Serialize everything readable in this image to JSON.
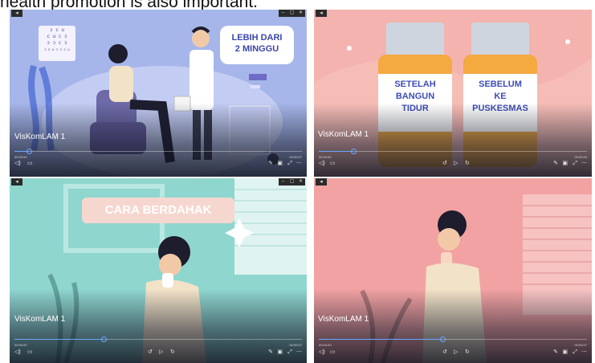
{
  "caption": "health promotion is also important.",
  "panels": [
    {
      "id": "p1",
      "title": "VisKomLAM 1",
      "progress": 0.05,
      "time_start": "00:00:00",
      "time_end": "00:00:07",
      "scene_text": [
        "LEBIH DARI",
        "2 MINGGU"
      ],
      "chart_text": [
        "ɔ c u",
        "c u c ɔ",
        "ɔ ɔ c ɔ",
        "ɔ n u ɔ ɔ ɔ u"
      ]
    },
    {
      "id": "p2",
      "title": "VisKomLAM 1",
      "progress": 0.13,
      "time_start": "00:00:00",
      "time_end": "00:00:00",
      "bottle_left": [
        "SETELAH",
        "BANGUN",
        "TIDUR"
      ],
      "bottle_right": [
        "SEBELUM",
        "KE",
        "PUSKESMAS"
      ]
    },
    {
      "id": "p3",
      "title": "VisKomLAM 1",
      "progress": 0.31,
      "time_start": "00:00:00",
      "time_end": "00:00:07",
      "scene_text": "CARA BERDAHAK"
    },
    {
      "id": "p4",
      "title": "VisKomLAM 1",
      "progress": 0.46,
      "time_start": "00:00:00",
      "time_end": "00:00:07"
    }
  ],
  "colors": {
    "accent": "#6aa7ff",
    "panel1_bg": "#a6b6ea",
    "panel2_bg": "#f4b3ae",
    "panel3_bg": "#8fd6cf",
    "panel4_bg": "#f2a2a2"
  },
  "icons": [
    "back-icon",
    "minimize-icon",
    "restore-icon",
    "close-icon",
    "volume-icon",
    "subtitle-icon",
    "rewind-icon",
    "play-icon",
    "forward-icon",
    "pen-icon",
    "screen-icon",
    "fullscreen-icon",
    "more-icon"
  ]
}
